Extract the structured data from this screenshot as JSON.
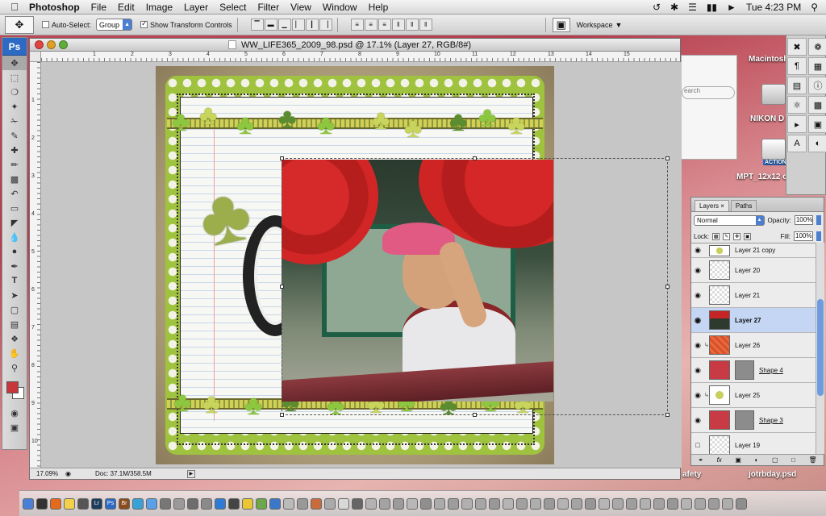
{
  "menubar": {
    "app_name": "Photoshop",
    "items": [
      "File",
      "Edit",
      "Image",
      "Layer",
      "Select",
      "Filter",
      "View",
      "Window",
      "Help"
    ],
    "clock": "Tue 4:23 PM"
  },
  "options": {
    "auto_select_label": "Auto-Select:",
    "auto_select_value": "Group",
    "show_transform_label": "Show Transform Controls",
    "workspace_label": "Workspace"
  },
  "toolbox": {
    "logo": "Ps",
    "tools": [
      "move-tool",
      "marquee-tool",
      "lasso-tool",
      "magic-wand-tool",
      "crop-tool",
      "eyedropper-tool",
      "healing-brush-tool",
      "brush-tool",
      "clone-stamp-tool",
      "history-brush-tool",
      "eraser-tool",
      "paint-bucket-tool",
      "blur-tool",
      "dodge-tool",
      "pen-tool",
      "type-tool",
      "path-select-tool",
      "shape-tool",
      "notes-tool",
      "3d-tool",
      "hand-tool",
      "zoom-tool"
    ],
    "foreground_color": "#c8363c",
    "background_color": "#ffffff"
  },
  "document": {
    "title": "WW_LIFE365_2009_98.psd @ 17.1% (Layer 27, RGB/8#)",
    "ruler_numbers": [
      "1",
      "2",
      "3",
      "4",
      "5",
      "6",
      "7",
      "8",
      "9",
      "10",
      "11",
      "12",
      "13",
      "14",
      "15"
    ],
    "zoom": "17.09%",
    "doc_size": "Doc: 37.1M/358.5M"
  },
  "finder": {
    "search_placeholder": "earch",
    "macintosh_label": "Macintosh",
    "nikon_label": "NIKON D",
    "file_label": "MPT_12x12 c",
    "action_label": "ACTION",
    "safety_label": "afety",
    "jotrbday_label": "jotrbday.psd"
  },
  "layers_panel": {
    "tabs": [
      "Layers",
      "Paths"
    ],
    "blend_mode": "Normal",
    "opacity_label": "Opacity:",
    "opacity_value": "100%",
    "lock_label": "Lock:",
    "fill_label": "Fill:",
    "fill_value": "100%",
    "layers": [
      {
        "name": "Layer 21 copy",
        "thumb": "green",
        "visible": true,
        "selected": false,
        "linked": false,
        "mask": false,
        "underline": false
      },
      {
        "name": "Layer 20",
        "thumb": "green",
        "visible": true,
        "selected": false,
        "linked": false,
        "mask": false,
        "underline": false
      },
      {
        "name": "Layer 21",
        "thumb": "green",
        "visible": true,
        "selected": false,
        "linked": false,
        "mask": false,
        "underline": false
      },
      {
        "name": "Layer 27",
        "thumb": "photo",
        "visible": true,
        "selected": true,
        "linked": false,
        "mask": false,
        "underline": false
      },
      {
        "name": "Layer 26",
        "thumb": "orange",
        "visible": true,
        "selected": false,
        "linked": true,
        "mask": false,
        "underline": false
      },
      {
        "name": "Shape 4",
        "thumb": "red",
        "visible": true,
        "selected": false,
        "linked": false,
        "mask": true,
        "underline": true
      },
      {
        "name": "Layer 25",
        "thumb": "green",
        "visible": true,
        "selected": false,
        "linked": true,
        "mask": false,
        "underline": false
      },
      {
        "name": "Shape 3",
        "thumb": "red",
        "visible": true,
        "selected": false,
        "linked": false,
        "mask": true,
        "underline": true
      },
      {
        "name": "Layer 19",
        "thumb": "checker",
        "visible": false,
        "selected": false,
        "linked": false,
        "mask": false,
        "underline": false
      }
    ]
  }
}
